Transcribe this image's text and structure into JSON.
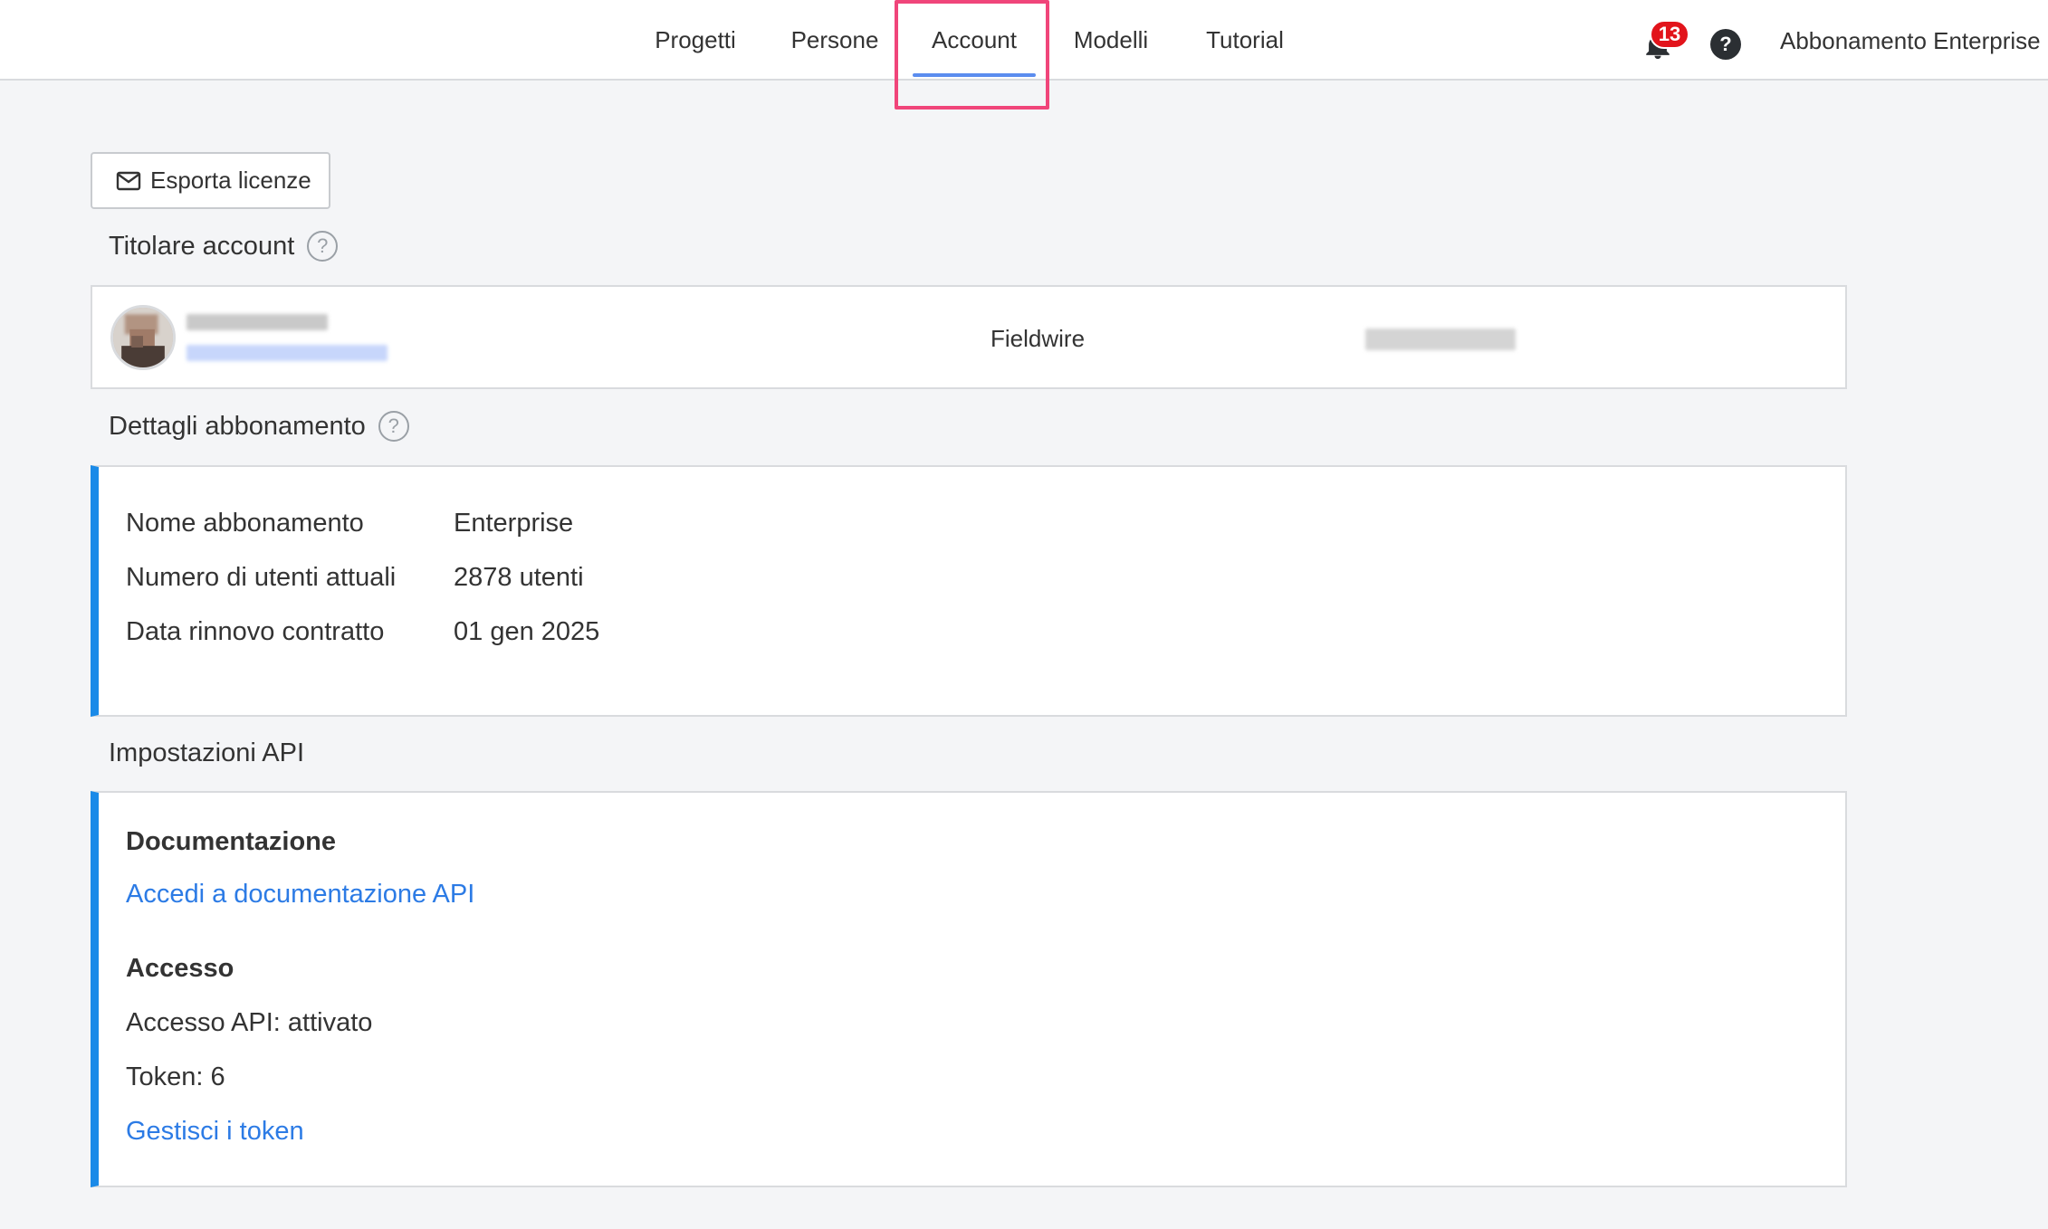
{
  "nav": {
    "tabs": [
      {
        "label": "Progetti"
      },
      {
        "label": "Persone"
      },
      {
        "label": "Account",
        "active": true
      },
      {
        "label": "Modelli"
      },
      {
        "label": "Tutorial"
      }
    ],
    "notifications_count": "13",
    "help_glyph": "?",
    "plan_label": "Abbonamento Enterprise"
  },
  "toolbar": {
    "export_label": "Esporta licenze"
  },
  "owner_section": {
    "title": "Titolare account",
    "company": "Fieldwire"
  },
  "subscription_section": {
    "title": "Dettagli abbonamento",
    "rows": [
      {
        "label": "Nome abbonamento",
        "value": "Enterprise"
      },
      {
        "label": "Numero di utenti attuali",
        "value": "2878 utenti"
      },
      {
        "label": "Data rinnovo contratto",
        "value": "01 gen 2025"
      }
    ]
  },
  "api_section": {
    "title": "Impostazioni API",
    "documentation_heading": "Documentazione",
    "documentation_link": "Accedi a documentazione API",
    "access_heading": "Accesso",
    "access_status": "Accesso API: attivato",
    "tokens": "Token: 6",
    "manage_tokens_link": "Gestisci i token"
  },
  "colors": {
    "accent": "#1a8ae8",
    "link": "#2c7be5",
    "highlight": "#f0457a",
    "badge": "#e2141b"
  },
  "icons": [
    "bell-icon",
    "help-icon",
    "mail-icon",
    "question-icon",
    "avatar"
  ]
}
